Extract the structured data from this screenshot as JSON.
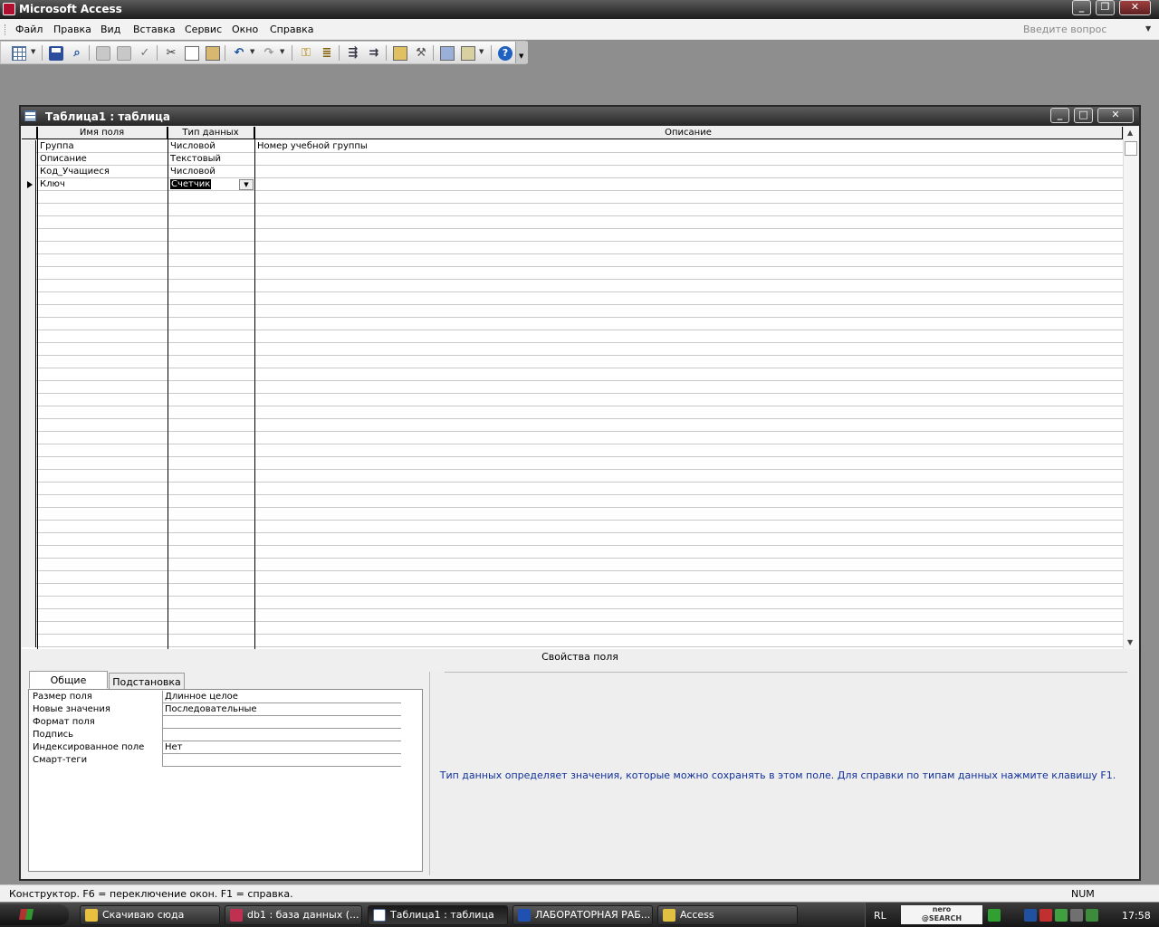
{
  "app": {
    "title": "Microsoft Access"
  },
  "menu": {
    "items": [
      "Файл",
      "Правка",
      "Вид",
      "Вставка",
      "Сервис",
      "Окно",
      "Справка"
    ],
    "ask_placeholder": "Введите вопрос"
  },
  "toolbar": {
    "icons": [
      "datasheet-view-icon",
      "save-icon",
      "search-icon",
      "print-icon",
      "print-preview-icon",
      "spelling-icon",
      "cut-icon",
      "copy-icon",
      "paste-icon",
      "undo-icon",
      "redo-icon",
      "primary-key-icon",
      "indexes-icon",
      "insert-rows-icon",
      "delete-rows-icon",
      "properties-icon",
      "build-icon",
      "database-window-icon",
      "new-object-icon",
      "help-icon"
    ]
  },
  "child_window": {
    "title": "Таблица1 : таблица",
    "columns": [
      "Имя поля",
      "Тип данных",
      "Описание"
    ],
    "rows": [
      {
        "name": "Группа",
        "type": "Числовой",
        "desc": "Номер учебной группы"
      },
      {
        "name": "Описание",
        "type": "Текстовый",
        "desc": ""
      },
      {
        "name": "Код_Учащиеся",
        "type": "Числовой",
        "desc": ""
      },
      {
        "name": "Ключ",
        "type": "Счетчик",
        "desc": ""
      }
    ],
    "current_row": 3
  },
  "field_properties": {
    "section_title": "Свойства поля",
    "tabs": [
      "Общие",
      "Подстановка"
    ],
    "active_tab": 0,
    "properties": [
      {
        "label": "Размер поля",
        "value": "Длинное целое"
      },
      {
        "label": "Новые значения",
        "value": "Последовательные"
      },
      {
        "label": "Формат поля",
        "value": ""
      },
      {
        "label": "Подпись",
        "value": ""
      },
      {
        "label": "Индексированное поле",
        "value": "Нет"
      },
      {
        "label": "Смарт-теги",
        "value": ""
      }
    ],
    "help_text": "Тип данных определяет значения, которые можно сохранять в этом поле.  Для справки по типам данных нажмите клавишу F1."
  },
  "status": {
    "text": "Конструктор.  F6 = переключение окон.  F1 = справка.",
    "num": "NUM"
  },
  "taskbar": {
    "tasks": [
      {
        "label": "Скачиваю сюда",
        "active": false
      },
      {
        "label": "db1 : база данных (...",
        "active": false
      },
      {
        "label": "Таблица1 : таблица",
        "active": true
      },
      {
        "label": "ЛАБОРАТОРНАЯ РАБ...",
        "active": false
      },
      {
        "label": "Access",
        "active": false
      }
    ],
    "lang": "RL",
    "nero_line1": "nero",
    "nero_line2": "@SEARCH",
    "clock": "17:58"
  }
}
